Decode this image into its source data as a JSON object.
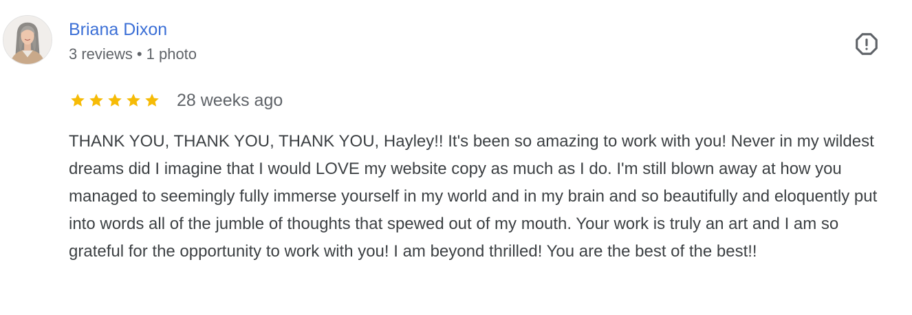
{
  "review": {
    "author_name": "Briana Dixon",
    "review_count": "3 reviews",
    "separator": "•",
    "photo_count": "1 photo",
    "rating": 5,
    "rating_max": 5,
    "date": "28 weeks ago",
    "text": "THANK YOU, THANK YOU, THANK YOU, Hayley!! It's been so amazing to work with you! Never in my wildest dreams did I imagine that I would LOVE my website copy as much as I do. I'm still blown away at how you managed to seemingly fully immerse yourself in my world and in my brain and so beautifully and eloquently put into words all of the jumble of thoughts that spewed out of my mouth. Your work is truly an art and I am so grateful for the opportunity to work with you! I am beyond thrilled! You are the best of the best!!"
  },
  "icons": {
    "report": "report-flag-icon",
    "star": "star-icon",
    "avatar": "profile-photo"
  },
  "colors": {
    "author_link": "#3b6fd6",
    "star_fill": "#f6bb06",
    "meta_text": "#5f6368",
    "body_text": "#3c4043"
  }
}
